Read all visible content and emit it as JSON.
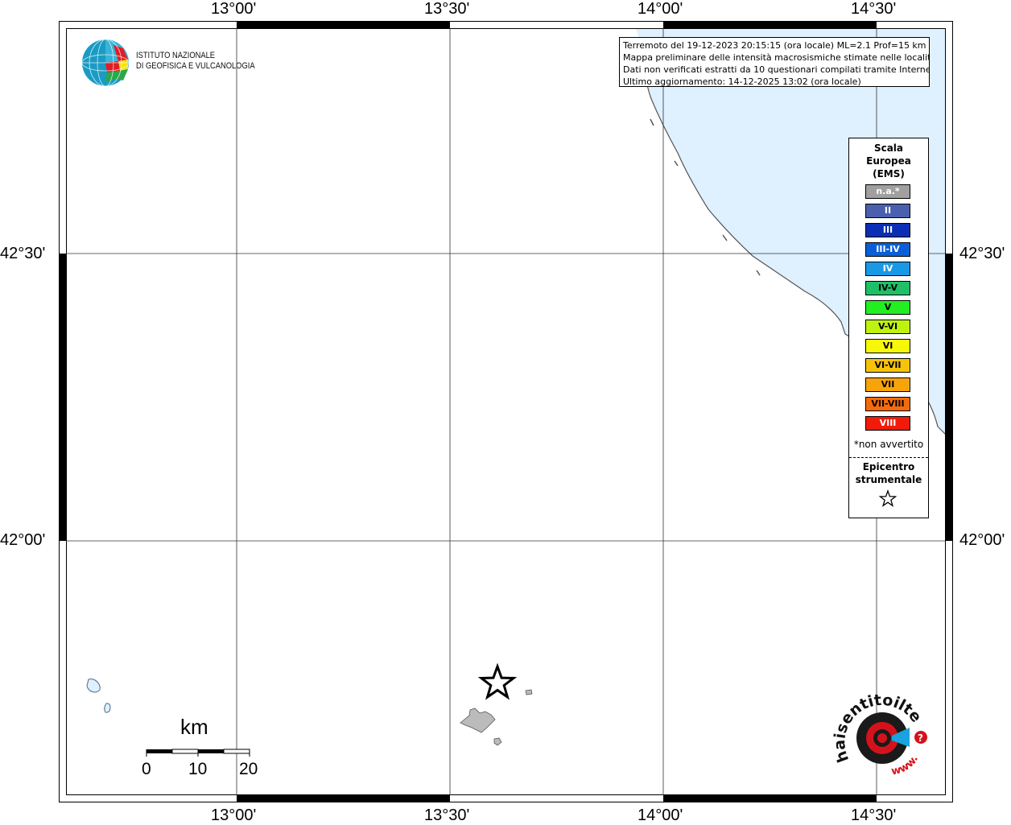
{
  "map": {
    "lon_labels": [
      "13°00'",
      "13°30'",
      "14°00'",
      "14°30'"
    ],
    "lat_labels": [
      "42°30'",
      "42°00'"
    ],
    "sea_color": "#dff0ff",
    "coast_color": "#555555"
  },
  "info_box": {
    "lines": [
      "Terremoto del 19-12-2023 20:15:15 (ora locale) ML=2.1 Prof=15 km",
      "Mappa preliminare delle intensità macrosismiche stimate nelle località",
      "Dati non verificati estratti da 10 questionari compilati tramite Internet.",
      "Ultimo aggiornamento: 14-12-2025 13:02 (ora locale)"
    ]
  },
  "legend": {
    "title_lines": [
      "Scala",
      "Europea",
      "(EMS)"
    ],
    "items": [
      {
        "label": "n.a.*",
        "color": "#a0a0a0",
        "text_color": "#ffffff"
      },
      {
        "label": "II",
        "color": "#4a5fae",
        "text_color": "#ffffff"
      },
      {
        "label": "III",
        "color": "#0a2fb4",
        "text_color": "#ffffff"
      },
      {
        "label": "III-IV",
        "color": "#0b5fd6",
        "text_color": "#ffffff"
      },
      {
        "label": "IV",
        "color": "#1899e6",
        "text_color": "#ffffff"
      },
      {
        "label": "IV-V",
        "color": "#1fbf68",
        "text_color": "#000000"
      },
      {
        "label": "V",
        "color": "#22ee22",
        "text_color": "#000000"
      },
      {
        "label": "V-VI",
        "color": "#bff20f",
        "text_color": "#000000"
      },
      {
        "label": "VI",
        "color": "#f7f70a",
        "text_color": "#000000"
      },
      {
        "label": "VI-VII",
        "color": "#f7c20a",
        "text_color": "#000000"
      },
      {
        "label": "VII",
        "color": "#f7a40a",
        "text_color": "#000000"
      },
      {
        "label": "VII-VIII",
        "color": "#f76a0a",
        "text_color": "#000000"
      },
      {
        "label": "VIII",
        "color": "#f21a0a",
        "text_color": "#ffffff"
      }
    ],
    "note": "*non avvertito",
    "epicenter_lines": [
      "Epicentro",
      "strumentale"
    ]
  },
  "logo_ingv": {
    "line1": "ISTITUTO NAZIONALE",
    "line2": "DI GEOFISICA E VULCANOLOGIA"
  },
  "scale_bar": {
    "title": "km",
    "labels": [
      "0",
      "10",
      "20"
    ]
  },
  "logo_hsit": {
    "text": "haisentitoilterremoto.it",
    "url_text": "www."
  }
}
